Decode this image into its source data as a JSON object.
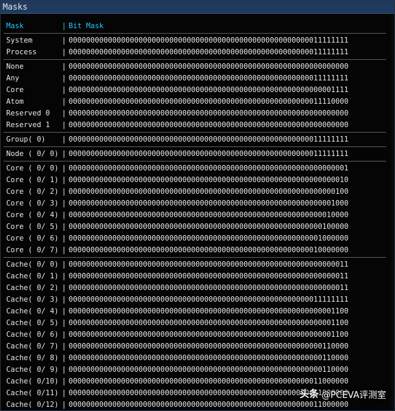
{
  "window": {
    "title": "Masks"
  },
  "table": {
    "header": {
      "mask": "Mask",
      "sep": "|",
      "bitmask": "Bit Mask"
    },
    "groups": [
      [
        {
          "label": "System",
          "bits": "0000000000000000000000000000000000000000000000000000000011111111"
        },
        {
          "label": "Process",
          "bits": "0000000000000000000000000000000000000000000000000000000011111111"
        }
      ],
      [
        {
          "label": "None",
          "bits": "0000000000000000000000000000000000000000000000000000000000000000"
        },
        {
          "label": "Any",
          "bits": "0000000000000000000000000000000000000000000000000000000011111111"
        },
        {
          "label": "Core",
          "bits": "0000000000000000000000000000000000000000000000000000000000001111"
        },
        {
          "label": "Atom",
          "bits": "0000000000000000000000000000000000000000000000000000000011110000"
        },
        {
          "label": "Reserved 0",
          "bits": "0000000000000000000000000000000000000000000000000000000000000000"
        },
        {
          "label": "Reserved 1",
          "bits": "0000000000000000000000000000000000000000000000000000000000000000"
        }
      ],
      [
        {
          "label": "Group( 0)",
          "bits": "0000000000000000000000000000000000000000000000000000000011111111"
        }
      ],
      [
        {
          "label": "Node ( 0/ 0)",
          "bits": "0000000000000000000000000000000000000000000000000000000011111111"
        }
      ],
      [
        {
          "label": "Core ( 0/ 0)",
          "bits": "0000000000000000000000000000000000000000000000000000000000000001"
        },
        {
          "label": "Core ( 0/ 1)",
          "bits": "0000000000000000000000000000000000000000000000000000000000000010"
        },
        {
          "label": "Core ( 0/ 2)",
          "bits": "0000000000000000000000000000000000000000000000000000000000000100"
        },
        {
          "label": "Core ( 0/ 3)",
          "bits": "0000000000000000000000000000000000000000000000000000000000001000"
        },
        {
          "label": "Core ( 0/ 4)",
          "bits": "0000000000000000000000000000000000000000000000000000000000010000"
        },
        {
          "label": "Core ( 0/ 5)",
          "bits": "0000000000000000000000000000000000000000000000000000000000100000"
        },
        {
          "label": "Core ( 0/ 6)",
          "bits": "0000000000000000000000000000000000000000000000000000000001000000"
        },
        {
          "label": "Core ( 0/ 7)",
          "bits": "0000000000000000000000000000000000000000000000000000000010000000"
        }
      ],
      [
        {
          "label": "Cache( 0/ 0)",
          "bits": "0000000000000000000000000000000000000000000000000000000000000011"
        },
        {
          "label": "Cache( 0/ 1)",
          "bits": "0000000000000000000000000000000000000000000000000000000000000011"
        },
        {
          "label": "Cache( 0/ 2)",
          "bits": "0000000000000000000000000000000000000000000000000000000000000011"
        },
        {
          "label": "Cache( 0/ 3)",
          "bits": "0000000000000000000000000000000000000000000000000000000011111111"
        },
        {
          "label": "Cache( 0/ 4)",
          "bits": "0000000000000000000000000000000000000000000000000000000000001100"
        },
        {
          "label": "Cache( 0/ 5)",
          "bits": "0000000000000000000000000000000000000000000000000000000000001100"
        },
        {
          "label": "Cache( 0/ 6)",
          "bits": "0000000000000000000000000000000000000000000000000000000000001100"
        },
        {
          "label": "Cache( 0/ 7)",
          "bits": "0000000000000000000000000000000000000000000000000000000000110000"
        },
        {
          "label": "Cache( 0/ 8)",
          "bits": "0000000000000000000000000000000000000000000000000000000000110000"
        },
        {
          "label": "Cache( 0/ 9)",
          "bits": "0000000000000000000000000000000000000000000000000000000000110000"
        },
        {
          "label": "Cache( 0/10)",
          "bits": "0000000000000000000000000000000000000000000000000000000011000000"
        },
        {
          "label": "Cache( 0/11)",
          "bits": "0000000000000000000000000000000000000000000000000000000011000000"
        },
        {
          "label": "Cache( 0/12)",
          "bits": "0000000000000000000000000000000000000000000000000000000011000000"
        }
      ]
    ]
  },
  "watermark": {
    "logo": "头条",
    "text": "@PCEVA评测室"
  },
  "colors": {
    "header_accent": "#26c6ff",
    "text": "#e6e6e6",
    "titlebar": "#1e3a5f"
  }
}
